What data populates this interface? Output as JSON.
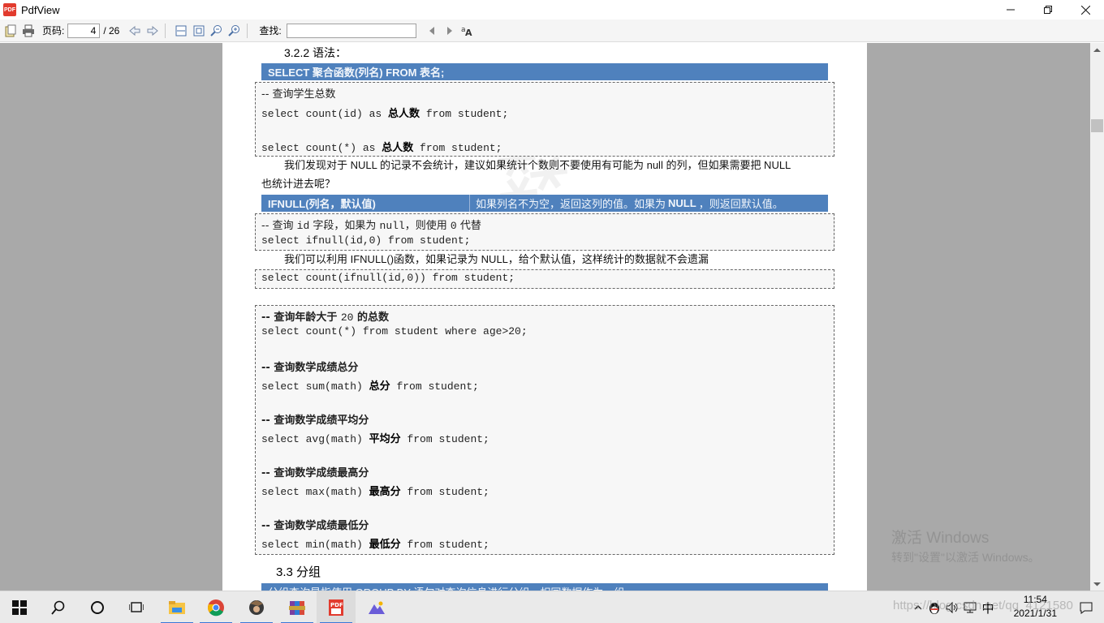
{
  "window": {
    "title": "PdfView",
    "app_icon_text": "PDF"
  },
  "toolbar": {
    "page_label": "页码:",
    "page_value": "4",
    "page_total": "/ 26",
    "find_label": "查找:",
    "find_value": ""
  },
  "document": {
    "section_322": "3.2.2 语法：",
    "syntax_bar": "SELECT 聚合函数(列名) FROM 表名;",
    "box1": {
      "comment": "-- 查询学生总数",
      "line1_a": "select count(id) as ",
      "line1_zh": "总人数",
      "line1_b": " from student;",
      "line2_a": "select count(*) as ",
      "line2_zh": "总人数",
      "line2_b": " from student;"
    },
    "para1_line1": "我们发现对于 NULL 的记录不会统计，建议如果统计个数则不要使用有可能为 null 的列，但如果需要把 NULL",
    "para1_line2": "也统计进去呢？",
    "ifnull_bar": {
      "cell1": "IFNULL(列名，默认值)",
      "cell2_a": "如果列名不为空，返回这列的值。如果为",
      "cell2_b": "NULL",
      "cell2_c": "，则返回默认值。"
    },
    "box2": {
      "comment_a": "-- 查询 ",
      "comment_id": "id",
      "comment_b": " 字段，如果为 ",
      "comment_null": "null",
      "comment_c": "，则使用 ",
      "comment_zero": "0",
      "comment_d": " 代替",
      "line1": "select ifnull(id,0) from student;"
    },
    "para2": "我们可以利用 IFNULL()函数，如果记录为 NULL，给个默认值，这样统计的数据就不会遗漏",
    "box3": {
      "line1": "select count(ifnull(id,0)) from student;"
    },
    "box4": {
      "c1_a": "-- 查询年龄大于 ",
      "c1_num": "20",
      "c1_b": " 的总数",
      "l1": "select count(*) from student where age>20;",
      "c2": "-- 查询数学成绩总分",
      "l2_a": "select sum(math) ",
      "l2_zh": "总分",
      "l2_b": " from student;",
      "c3": "-- 查询数学成绩平均分",
      "l3_a": "select avg(math) ",
      "l3_zh": "平均分",
      "l3_b": " from student;",
      "c4": "-- 查询数学成绩最高分",
      "l4_a": "select max(math) ",
      "l4_zh": "最高分",
      "l4_b": " from student;",
      "c5": "-- 查询数学成绩最低分",
      "l5_a": "select min(math) ",
      "l5_zh": "最低分",
      "l5_b": " from student;"
    },
    "section_33": "3.3    分组",
    "bottom_bar": "分组查询是指使用 GROUP BY 语句对查询信息进行分组，相同数据作为一组"
  },
  "activation": {
    "line1": "激活 Windows",
    "line2": "转到\"设置\"以激活 Windows。"
  },
  "taskbar": {
    "clock_time": "11:54",
    "clock_date": "2021/1/31",
    "ime": "中",
    "url_watermark": "https://blog.csdn.net/qq_4121580"
  }
}
